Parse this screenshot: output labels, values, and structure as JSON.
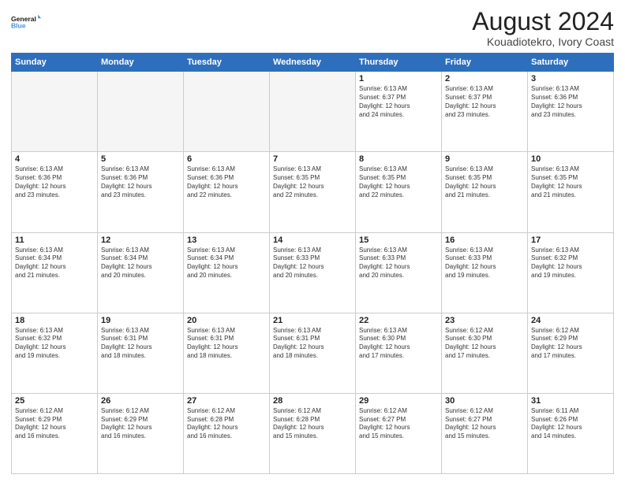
{
  "logo": {
    "line1": "General",
    "line2": "Blue"
  },
  "title": "August 2024",
  "subtitle": "Kouadiotekro, Ivory Coast",
  "header_days": [
    "Sunday",
    "Monday",
    "Tuesday",
    "Wednesday",
    "Thursday",
    "Friday",
    "Saturday"
  ],
  "weeks": [
    [
      {
        "day": "",
        "info": ""
      },
      {
        "day": "",
        "info": ""
      },
      {
        "day": "",
        "info": ""
      },
      {
        "day": "",
        "info": ""
      },
      {
        "day": "1",
        "info": "Sunrise: 6:13 AM\nSunset: 6:37 PM\nDaylight: 12 hours\nand 24 minutes."
      },
      {
        "day": "2",
        "info": "Sunrise: 6:13 AM\nSunset: 6:37 PM\nDaylight: 12 hours\nand 23 minutes."
      },
      {
        "day": "3",
        "info": "Sunrise: 6:13 AM\nSunset: 6:36 PM\nDaylight: 12 hours\nand 23 minutes."
      }
    ],
    [
      {
        "day": "4",
        "info": "Sunrise: 6:13 AM\nSunset: 6:36 PM\nDaylight: 12 hours\nand 23 minutes."
      },
      {
        "day": "5",
        "info": "Sunrise: 6:13 AM\nSunset: 6:36 PM\nDaylight: 12 hours\nand 23 minutes."
      },
      {
        "day": "6",
        "info": "Sunrise: 6:13 AM\nSunset: 6:36 PM\nDaylight: 12 hours\nand 22 minutes."
      },
      {
        "day": "7",
        "info": "Sunrise: 6:13 AM\nSunset: 6:35 PM\nDaylight: 12 hours\nand 22 minutes."
      },
      {
        "day": "8",
        "info": "Sunrise: 6:13 AM\nSunset: 6:35 PM\nDaylight: 12 hours\nand 22 minutes."
      },
      {
        "day": "9",
        "info": "Sunrise: 6:13 AM\nSunset: 6:35 PM\nDaylight: 12 hours\nand 21 minutes."
      },
      {
        "day": "10",
        "info": "Sunrise: 6:13 AM\nSunset: 6:35 PM\nDaylight: 12 hours\nand 21 minutes."
      }
    ],
    [
      {
        "day": "11",
        "info": "Sunrise: 6:13 AM\nSunset: 6:34 PM\nDaylight: 12 hours\nand 21 minutes."
      },
      {
        "day": "12",
        "info": "Sunrise: 6:13 AM\nSunset: 6:34 PM\nDaylight: 12 hours\nand 20 minutes."
      },
      {
        "day": "13",
        "info": "Sunrise: 6:13 AM\nSunset: 6:34 PM\nDaylight: 12 hours\nand 20 minutes."
      },
      {
        "day": "14",
        "info": "Sunrise: 6:13 AM\nSunset: 6:33 PM\nDaylight: 12 hours\nand 20 minutes."
      },
      {
        "day": "15",
        "info": "Sunrise: 6:13 AM\nSunset: 6:33 PM\nDaylight: 12 hours\nand 20 minutes."
      },
      {
        "day": "16",
        "info": "Sunrise: 6:13 AM\nSunset: 6:33 PM\nDaylight: 12 hours\nand 19 minutes."
      },
      {
        "day": "17",
        "info": "Sunrise: 6:13 AM\nSunset: 6:32 PM\nDaylight: 12 hours\nand 19 minutes."
      }
    ],
    [
      {
        "day": "18",
        "info": "Sunrise: 6:13 AM\nSunset: 6:32 PM\nDaylight: 12 hours\nand 19 minutes."
      },
      {
        "day": "19",
        "info": "Sunrise: 6:13 AM\nSunset: 6:31 PM\nDaylight: 12 hours\nand 18 minutes."
      },
      {
        "day": "20",
        "info": "Sunrise: 6:13 AM\nSunset: 6:31 PM\nDaylight: 12 hours\nand 18 minutes."
      },
      {
        "day": "21",
        "info": "Sunrise: 6:13 AM\nSunset: 6:31 PM\nDaylight: 12 hours\nand 18 minutes."
      },
      {
        "day": "22",
        "info": "Sunrise: 6:13 AM\nSunset: 6:30 PM\nDaylight: 12 hours\nand 17 minutes."
      },
      {
        "day": "23",
        "info": "Sunrise: 6:12 AM\nSunset: 6:30 PM\nDaylight: 12 hours\nand 17 minutes."
      },
      {
        "day": "24",
        "info": "Sunrise: 6:12 AM\nSunset: 6:29 PM\nDaylight: 12 hours\nand 17 minutes."
      }
    ],
    [
      {
        "day": "25",
        "info": "Sunrise: 6:12 AM\nSunset: 6:29 PM\nDaylight: 12 hours\nand 16 minutes."
      },
      {
        "day": "26",
        "info": "Sunrise: 6:12 AM\nSunset: 6:29 PM\nDaylight: 12 hours\nand 16 minutes."
      },
      {
        "day": "27",
        "info": "Sunrise: 6:12 AM\nSunset: 6:28 PM\nDaylight: 12 hours\nand 16 minutes."
      },
      {
        "day": "28",
        "info": "Sunrise: 6:12 AM\nSunset: 6:28 PM\nDaylight: 12 hours\nand 15 minutes."
      },
      {
        "day": "29",
        "info": "Sunrise: 6:12 AM\nSunset: 6:27 PM\nDaylight: 12 hours\nand 15 minutes."
      },
      {
        "day": "30",
        "info": "Sunrise: 6:12 AM\nSunset: 6:27 PM\nDaylight: 12 hours\nand 15 minutes."
      },
      {
        "day": "31",
        "info": "Sunrise: 6:11 AM\nSunset: 6:26 PM\nDaylight: 12 hours\nand 14 minutes."
      }
    ]
  ]
}
